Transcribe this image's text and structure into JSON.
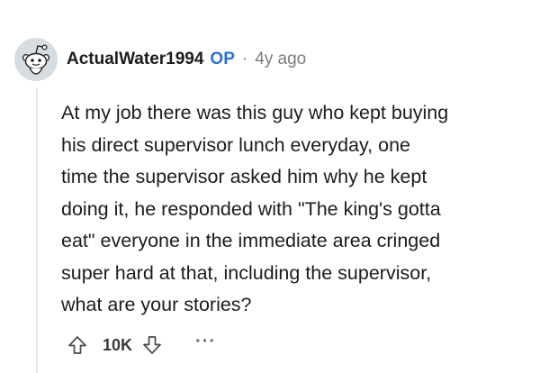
{
  "comment": {
    "author": "ActualWater1994",
    "op_badge": "OP",
    "separator": "·",
    "age": "4y ago",
    "body": "At my job there was this guy who kept buying\nhis direct supervisor lunch everyday, one\ntime the supervisor asked him why he kept\ndoing it, he responded with \"The king's gotta\neat\" everyone in the immediate area cringed\nsuper hard at that, including the supervisor,\nwhat are your stories?",
    "score": "10K",
    "more_label": "···",
    "avatar_icon": "snoo-avatar-icon",
    "upvote_icon": "upvote-arrow-icon",
    "downvote_icon": "downvote-arrow-icon",
    "colors": {
      "op": "#2f6fd0",
      "meta": "#7c7c7c",
      "text": "#1c1c1c",
      "thread_line": "#e6e9ec"
    }
  }
}
